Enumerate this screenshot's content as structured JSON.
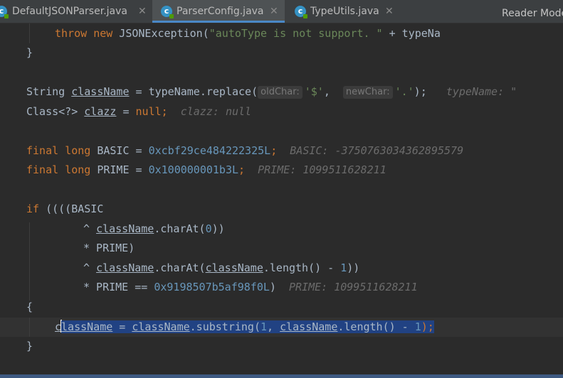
{
  "tabs": [
    {
      "icon": "class-icon",
      "label": "DefaultJSONParser.java",
      "active": false
    },
    {
      "icon": "class-icon",
      "label": "ParserConfig.java",
      "active": true
    },
    {
      "icon": "class-icon",
      "label": "TypeUtils.java",
      "active": false
    }
  ],
  "tab_close_glyph": "✕",
  "reader_mode_label": "Reader Mode",
  "code": {
    "l1": {
      "kw1": "throw",
      "kw2": "new",
      "cls": " JSONException(",
      "str": "\"autoType is not support. \"",
      "rest": " + typeNa"
    },
    "l2": {
      "text": "}"
    },
    "l3": {
      "type": "String ",
      "var": "className",
      "mid": " = typeName.replace(",
      "hint1": "oldChar:",
      "str1": "'$'",
      "comma": ", ",
      "hint2": "newChar:",
      "str2": "'.'",
      "end": ");",
      "dbg": "typeName: \""
    },
    "l4": {
      "type": "Class<?> ",
      "var": "clazz",
      "eq": " = ",
      "kw": "null",
      "end": ";",
      "dbg": "clazz: null"
    },
    "l5": {
      "kw1": "final",
      "kw2": "long",
      "name": " BASIC = ",
      "num": "0xcbf29ce484222325L",
      "end": ";",
      "dbg": "BASIC: -3750763034362895579"
    },
    "l6": {
      "kw1": "final",
      "kw2": "long",
      "name": " PRIME = ",
      "num": "0x100000001b3L",
      "end": ";",
      "dbg": "PRIME: 1099511628211"
    },
    "l7": {
      "kw": "if",
      "rest": " ((((BASIC"
    },
    "l8": {
      "op": "^ ",
      "var": "className",
      "mid": ".charAt(",
      "num": "0",
      "end": "))"
    },
    "l9": {
      "text": "* PRIME)"
    },
    "l10": {
      "op": "^ ",
      "var1": "className",
      "mid1": ".charAt(",
      "var2": "className",
      "mid2": ".length() - ",
      "num": "1",
      "end": "))"
    },
    "l11": {
      "pre": "* PRIME == ",
      "num": "0x9198507b5af98f0L",
      "end": ")",
      "dbg": "PRIME: 1099511628211"
    },
    "l12": {
      "text": "{"
    },
    "l13": {
      "c": "c",
      "var_rest": "lassName",
      "eq": " = ",
      "var2": "className",
      "mid": ".substring(",
      "num1": "1",
      "comma": ", ",
      "var3": "className",
      "mid2": ".length() - ",
      "num2": "1",
      "end": ");"
    },
    "l14": {
      "text": "}"
    }
  },
  "colors": {
    "background": "#2b2b2b",
    "keyword": "#cc7832",
    "string": "#6a8759",
    "number": "#6897bb",
    "selection": "#214283",
    "active_tab_underline": "#4a88c7"
  }
}
